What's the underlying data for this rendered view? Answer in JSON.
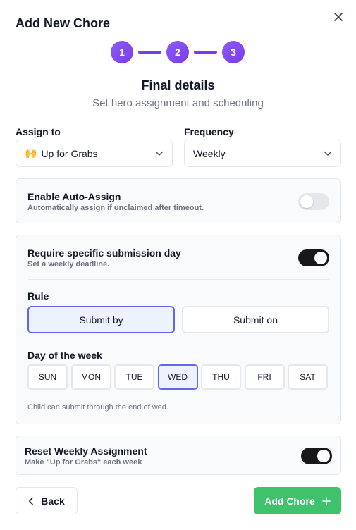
{
  "modal": {
    "title": "Add New Chore"
  },
  "stepper": {
    "steps": [
      "1",
      "2",
      "3"
    ],
    "current": 3
  },
  "step": {
    "title": "Final details",
    "subtitle": "Set hero assignment and scheduling"
  },
  "assign": {
    "label": "Assign to",
    "emoji": "🙌",
    "value": "Up for Grabs"
  },
  "frequency": {
    "label": "Frequency",
    "value": "Weekly"
  },
  "auto_assign": {
    "title": "Enable Auto-Assign",
    "desc": "Automatically assign if unclaimed after timeout.",
    "enabled": false
  },
  "submission": {
    "title": "Require specific submission day",
    "desc": "Set a weekly deadline.",
    "enabled": true,
    "rule_label": "Rule",
    "rules": [
      "Submit by",
      "Submit on"
    ],
    "selected_rule": "Submit by",
    "day_label": "Day of the week",
    "days": [
      "SUN",
      "MON",
      "TUE",
      "WED",
      "THU",
      "FRI",
      "SAT"
    ],
    "selected_day": "WED",
    "hint": "Child can submit through the end of wed."
  },
  "reset": {
    "title": "Reset Weekly Assignment",
    "desc": "Make \"Up for Grabs\" each week",
    "enabled": true
  },
  "footer": {
    "back_label": "Back",
    "add_label": "Add Chore"
  },
  "colors": {
    "accent": "#7c3aed",
    "selected_border": "#6366f1",
    "selected_bg": "#eef2ff",
    "toggle_on": "#18181b",
    "toggle_off": "#e5e7eb",
    "primary_button": "#3fc26b"
  }
}
